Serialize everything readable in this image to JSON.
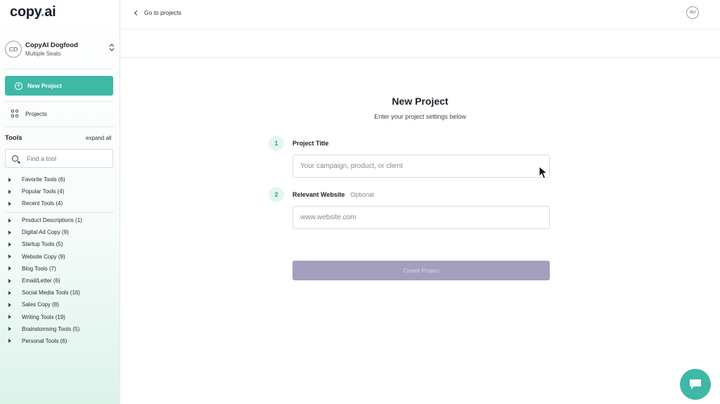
{
  "brand": {
    "logo_main": "copy",
    "logo_dot": ".",
    "logo_suffix": "ai"
  },
  "workspace": {
    "initials": "CD",
    "name": "CopyAI Dogfood",
    "plan": "Multiple Seats"
  },
  "sidebar": {
    "new_project_label": "New Project",
    "projects_label": "Projects",
    "tools_heading": "Tools",
    "expand_all_label": "expand all",
    "search_placeholder": "Find a tool",
    "quick_groups": [
      {
        "label": "Favorite Tools (6)"
      },
      {
        "label": "Popular Tools (4)"
      },
      {
        "label": "Recent Tools (4)"
      }
    ],
    "categories": [
      {
        "label": "Product Descriptions (1)"
      },
      {
        "label": "Digital Ad Copy (9)"
      },
      {
        "label": "Startup Tools (5)"
      },
      {
        "label": "Website Copy (9)"
      },
      {
        "label": "Blog Tools (7)"
      },
      {
        "label": "Email/Letter (6)"
      },
      {
        "label": "Social Media Tools (16)"
      },
      {
        "label": "Sales Copy (8)"
      },
      {
        "label": "Writing Tools (19)"
      },
      {
        "label": "Brainstorming Tools (5)"
      },
      {
        "label": "Personal Tools (6)"
      }
    ]
  },
  "topbar": {
    "back_label": "Go to projects",
    "user_initials": "AU"
  },
  "form": {
    "title": "New Project",
    "subtitle": "Enter your project settings below",
    "fields": [
      {
        "step": "1",
        "label": "Project Title",
        "optional": "",
        "placeholder": "Your campaign, product, or client",
        "value": ""
      },
      {
        "step": "2",
        "label": "Relevant Website",
        "optional": "Optional",
        "placeholder": "www.website.com",
        "value": ""
      }
    ],
    "submit_label": "Create Project"
  },
  "colors": {
    "accent": "#3fb8a6",
    "disabled_button": "#a3a0be",
    "step_bg": "#e4f6f1"
  },
  "icons": [
    "plus-circle-icon",
    "grid-icon",
    "search-icon",
    "caret-right-icon",
    "chevron-left-icon",
    "chevron-updown-icon",
    "chat-icon",
    "cursor-icon"
  ]
}
